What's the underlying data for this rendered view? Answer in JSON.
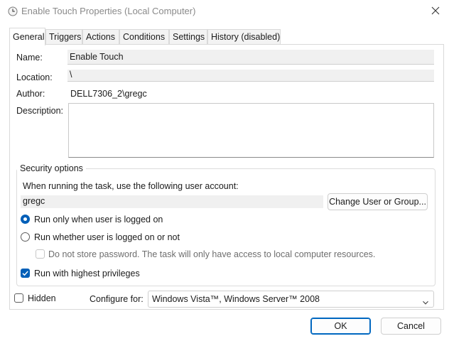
{
  "window": {
    "title": "Enable Touch Properties (Local Computer)",
    "icon": "clock-properties-icon"
  },
  "tabs": [
    {
      "label": "General",
      "active": true
    },
    {
      "label": "Triggers",
      "active": false
    },
    {
      "label": "Actions",
      "active": false
    },
    {
      "label": "Conditions",
      "active": false
    },
    {
      "label": "Settings",
      "active": false
    },
    {
      "label": "History (disabled)",
      "active": false
    }
  ],
  "general": {
    "name_label": "Name:",
    "name_value": "Enable Touch",
    "location_label": "Location:",
    "location_value": "\\",
    "author_label": "Author:",
    "author_value": "DELL7306_2\\gregc",
    "description_label": "Description:",
    "description_value": ""
  },
  "security": {
    "title": "Security options",
    "prompt": "When running the task, use the following user account:",
    "account": "gregc",
    "change_button": "Change User or Group...",
    "radio_logged_on": "Run only when user is logged on",
    "radio_logged_on_checked": true,
    "radio_whether": "Run whether user is logged on or not",
    "radio_whether_checked": false,
    "no_store_password": "Do not store password.  The task will only have access to local computer resources.",
    "no_store_password_checked": false,
    "highest_privileges": "Run with highest privileges",
    "highest_privileges_checked": true
  },
  "footer": {
    "hidden_label": "Hidden",
    "hidden_checked": false,
    "configure_label": "Configure for:",
    "configure_value": "Windows Vista™, Windows Server™ 2008",
    "ok_button": "OK",
    "cancel_button": "Cancel"
  },
  "colors": {
    "accent": "#005fb8",
    "title_text": "#8a8a8a",
    "field_bg": "#f0f0f0"
  }
}
